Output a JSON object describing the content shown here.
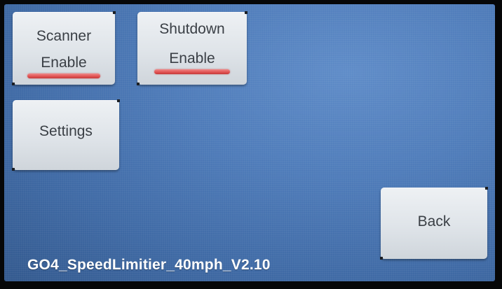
{
  "buttons": {
    "scanner": {
      "line1": "Scanner",
      "line2": "Enable",
      "indicator_color": "#e05252"
    },
    "shutdown": {
      "line1": "Shutdown",
      "line2": "Enable",
      "indicator_color": "#e05252"
    },
    "settings": {
      "label": "Settings"
    },
    "back": {
      "label": "Back"
    }
  },
  "footer": {
    "firmware_label": "GO4_SpeedLimitier_40mph_V2.10"
  },
  "colors": {
    "screen_background": "#4f7cba",
    "button_face": "#dfe4e9",
    "button_text": "#3a3f45",
    "footer_text": "#ffffff"
  }
}
